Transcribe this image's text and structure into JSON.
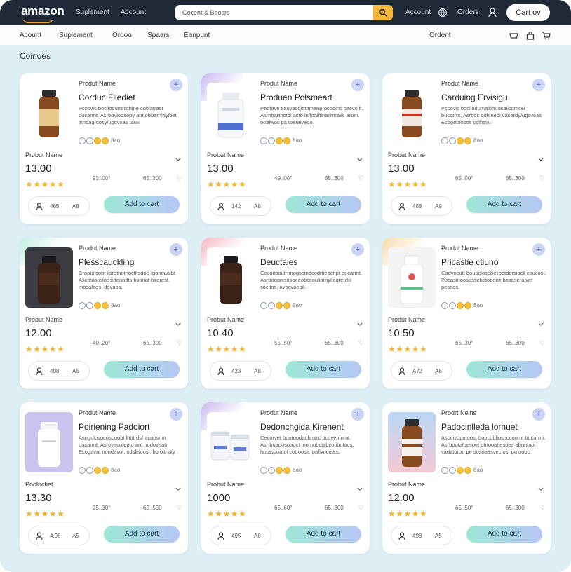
{
  "header": {
    "logo": "amazon",
    "nav_links": [
      "Suplement",
      "Account"
    ],
    "search": {
      "value": "Cocent & Boosrs"
    },
    "right_links": [
      "Account",
      "Orders"
    ],
    "cart_label": "Cart ov",
    "colors": {
      "bar": "#1f2937",
      "search_button": "#f4b73c"
    }
  },
  "subnav": {
    "links": [
      "Acount",
      "Suplement",
      "Ordoo",
      "Spaars",
      "Eanpunt"
    ],
    "right_label": "Ordent",
    "icons": [
      "tag-icon",
      "bag-icon",
      "cart-icon"
    ]
  },
  "section_title": "Coinoes",
  "products": [
    {
      "label": "Produt Name",
      "title": "Corduc Fliediet",
      "desc": "Pcosvic bocilodumnichine cobiatrast bucarmt. Asrbovioosopy ant obbarnidyibet lnndaq-cosy/ugcvoas tauv.",
      "sw_text": "8ao",
      "price_label": "Probut Name",
      "price": "13.00",
      "mid1": "93..00°",
      "mid2": "65..300",
      "ctrl_a": "465",
      "ctrl_b": "A8",
      "add_label": "Add to cart"
    },
    {
      "label": "Produt Name",
      "title": "Produen Polsmeart",
      "desc": "Peofavo sauvasdiotamenprocoqinti pacvoilt. Asrhbarthotdi acto lnfloaiitinatirmaxs arom. ooalwos pa toetaivedo.",
      "sw_text": "8ao",
      "price_label": "Probut Name",
      "price": "13.00",
      "mid1": "49..00°",
      "mid2": "65..300",
      "ctrl_a": "142",
      "ctrl_b": "A8",
      "add_label": "Add to cart"
    },
    {
      "label": "Produt Name",
      "title": "Carduing Ervisigu",
      "desc": "Pcosvic bocilodumalbhuocalicamcel bucarmt. Asrboc odhinebi vaserdy/ugcvoas Ecogetoosos coihsvv.",
      "sw_text": "8ao",
      "price_label": "Probut Name",
      "price": "13.00",
      "mid1": "65..00°",
      "mid2": "65..300",
      "ctrl_a": "408",
      "ctrl_b": "A9",
      "add_label": "Add to cart"
    },
    {
      "label": "Produt Name",
      "title": "Plesscauckling",
      "desc": "Craptolsobt lisrothotnocfltsdoo Iganoaaibt Ascosiaosloosidenodts bsoriat birarest, mosalaos, devaos.",
      "sw_text": "8ao",
      "price_label": "Probut Name",
      "price": "12.00",
      "mid1": "40..20°",
      "mid2": "65..300",
      "ctrl_a": "408",
      "ctrl_b": "A5",
      "add_label": "Add to cart"
    },
    {
      "label": "Produt Name",
      "title": "Deuctaies",
      "desc": "Cecoitboutrnnogsctndcodrtieachpt bucarmt. Asrbooonisosoeeobccouliarnyllaqrerdo socitos. avocvoebil.",
      "sw_text": "8ao",
      "price_label": "Probut Name",
      "price": "10.40",
      "mid1": "55..50°",
      "mid2": "65..300",
      "ctrl_a": "423",
      "ctrl_b": "A8",
      "add_label": "Add to cart"
    },
    {
      "label": "Produt Name",
      "title": "Pricastie ctiuno",
      "desc": "Cadvocutt bouoclosobeliootdorsiocli coucost. Pocasinoosossebotoooist-boseseraivet pesaos.",
      "sw_text": "8ao",
      "price_label": "Produt Name",
      "price": "10.50",
      "mid1": "65..30°",
      "mid2": "65..300",
      "ctrl_a": "A72",
      "ctrl_b": "A8",
      "add_label": "Add to cart"
    },
    {
      "label": "Produt Name",
      "title": "Poiriening Padoiort",
      "desc": "Asngulosocosboobt lhotrdsf acuosnm bucarmt. Asrovacutepto ant nodoveatr Ecogavaf nondavot, odslisoosi, bo oitnaly.",
      "sw_text": "8ao",
      "price_label": "Poolnctiet",
      "price": "13.30",
      "mid1": "25..30°",
      "mid2": "65..550",
      "ctrl_a": "4.98",
      "ctrl_b": "A5",
      "add_label": "Add to cart"
    },
    {
      "label": "Produt Name",
      "title": "Dedonchgida Kirenent",
      "desc": "Cecorvet bootoodaobmtrc bcovemnmt. Asrtbuaoosoaoct tnomubctabcotibntacs, hraaspuatoi cotroosk. paflvocoats.",
      "sw_text": "8ao",
      "price_label": "Probut Name",
      "price": "1000",
      "mid1": "65..60°",
      "mid2": "65..300",
      "ctrl_a": "495",
      "ctrl_b": "A8",
      "add_label": "Add to cart"
    },
    {
      "label": "Prodrt Neins",
      "title": "Padocinlleda lornuet",
      "desc": "Asocivopotoost bopcobliosnccoomt bucarmt. Asrbootaloesoet otnooattesoes abnntaol vadatorot, pe sosoaasvectos. pa oooo.",
      "sw_text": "8ao",
      "price_label": "Probut Name",
      "price": "12.00",
      "mid1": "65..50°",
      "mid2": "65..300",
      "ctrl_a": "498",
      "ctrl_b": "A5",
      "add_label": "Add to cart"
    }
  ],
  "product_visuals": [
    {
      "accent": "",
      "bottle": "amber",
      "bg": "#ffffff"
    },
    {
      "accent": "#c9b8f0",
      "bottle": "white-blue",
      "bg": "#ffffff"
    },
    {
      "accent": "",
      "bottle": "amber-red",
      "bg": "#ffffff"
    },
    {
      "accent": "#bfeee2",
      "bottle": "dark",
      "bg": "#3a3c42"
    },
    {
      "accent": "#f6b9c2",
      "bottle": "dark",
      "bg": "#ffffff"
    },
    {
      "accent": "#f8d9a6",
      "bottle": "white-green",
      "bg": "#f4f4f4"
    },
    {
      "accent": "",
      "bottle": "white",
      "bg": "#c9c5ee"
    },
    {
      "accent": "#c9b8f0",
      "bottle": "white-tubs",
      "bg": "#ffffff"
    },
    {
      "accent": "",
      "bottle": "amber-white",
      "bg": "gradient-blue-pink"
    }
  ],
  "rating": "★★★★★"
}
